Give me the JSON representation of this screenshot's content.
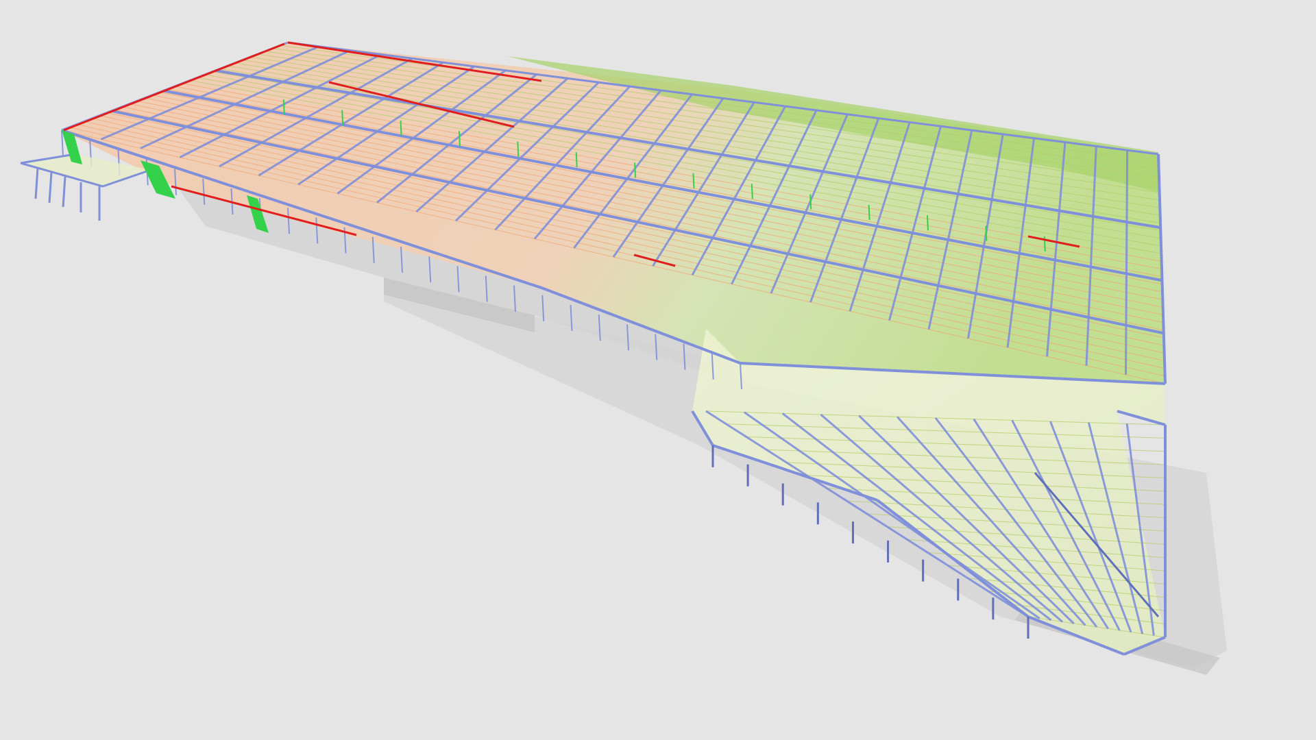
{
  "viewport": {
    "background": "#e5e5e5"
  },
  "model": {
    "kind": "structural-steel-frame-3d",
    "colors": {
      "beam_blue": "#7f8fd9",
      "beam_dark": "#5f6fb8",
      "purlin_green": "#b5cd6c",
      "purlin_yellow": "#e4de93",
      "roof_orange": "#f0a977",
      "roof_green": "#9fce5f",
      "highlight_red": "#e01e1e",
      "brace_green": "#33d24a",
      "wall_grey": "#cfcfcf",
      "shadow_grey": "#bdbdbd"
    }
  }
}
